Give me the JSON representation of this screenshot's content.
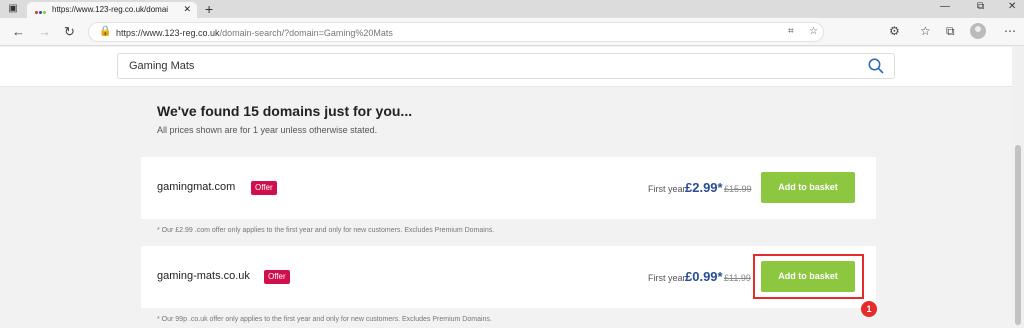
{
  "browser": {
    "tab_title": "https://www.123-reg.co.uk/domai",
    "url_prefix": "https://www.123-reg.co.uk",
    "url_rest": "/domain-search/?domain=Gaming%20Mats"
  },
  "search": {
    "value": "Gaming Mats"
  },
  "results": {
    "heading": "We've found 15 domains just for you...",
    "subheading": "All prices shown are for 1 year unless otherwise stated.",
    "items": [
      {
        "domain": "gamingmat.com",
        "badge": "Offer",
        "first_year_label": "First year",
        "price": "£2.99*",
        "old_price": "£15.99",
        "button": "Add to basket",
        "note": "* Our £2.99 .com offer only applies to the first year and only for new customers. Excludes Premium Domains."
      },
      {
        "domain": "gaming-mats.co.uk",
        "badge": "Offer",
        "first_year_label": "First year",
        "price": "£0.99*",
        "old_price": "£11.99",
        "button": "Add to basket",
        "note": "* Our 99p .co.uk offer only applies to the first year and only for new customers. Excludes Premium Domains."
      }
    ]
  },
  "annotation": {
    "step": "1"
  },
  "colors": {
    "brand_green": "#8dc63f",
    "offer_badge": "#d0104c",
    "price_blue": "#2a4c97",
    "highlight_red": "#e52b2b"
  }
}
